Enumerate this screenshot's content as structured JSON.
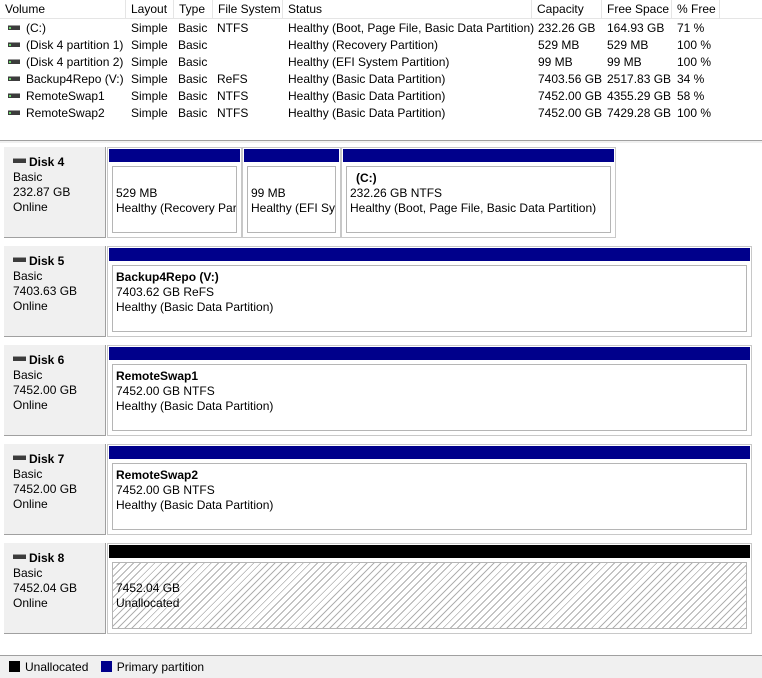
{
  "table": {
    "columns": [
      "Volume",
      "Layout",
      "Type",
      "File System",
      "Status",
      "Capacity",
      "Free Space",
      "% Free"
    ],
    "rows": [
      [
        "(C:)",
        "Simple",
        "Basic",
        "NTFS",
        "Healthy (Boot, Page File, Basic Data Partition)",
        "232.26 GB",
        "164.93 GB",
        "71 %"
      ],
      [
        "(Disk 4 partition 1)",
        "Simple",
        "Basic",
        "",
        "Healthy (Recovery Partition)",
        "529 MB",
        "529 MB",
        "100 %"
      ],
      [
        "(Disk 4 partition 2)",
        "Simple",
        "Basic",
        "",
        "Healthy (EFI System Partition)",
        "99 MB",
        "99 MB",
        "100 %"
      ],
      [
        "Backup4Repo (V:)",
        "Simple",
        "Basic",
        "ReFS",
        "Healthy (Basic Data Partition)",
        "7403.56 GB",
        "2517.83 GB",
        "34 %"
      ],
      [
        "RemoteSwap1",
        "Simple",
        "Basic",
        "NTFS",
        "Healthy (Basic Data Partition)",
        "7452.00 GB",
        "4355.29 GB",
        "58 %"
      ],
      [
        "RemoteSwap2",
        "Simple",
        "Basic",
        "NTFS",
        "Healthy (Basic Data Partition)",
        "7452.00 GB",
        "7429.28 GB",
        "100 %"
      ]
    ]
  },
  "disks": [
    {
      "name": "Disk 4",
      "type": "Basic",
      "size": "232.87 GB",
      "status": "Online",
      "partitions": [
        {
          "title": "",
          "size": "529 MB",
          "status": "Healthy (Recovery Part"
        },
        {
          "title": "",
          "size": "99 MB",
          "status": "Healthy (EFI Sys"
        },
        {
          "title": "(C:)",
          "size": "232.26 GB NTFS",
          "status": "Healthy (Boot, Page File, Basic Data Partition)"
        }
      ]
    },
    {
      "name": "Disk 5",
      "type": "Basic",
      "size": "7403.63 GB",
      "status": "Online",
      "partitions": [
        {
          "title": "Backup4Repo  (V:)",
          "size": "7403.62 GB ReFS",
          "status": "Healthy (Basic Data Partition)"
        }
      ]
    },
    {
      "name": "Disk 6",
      "type": "Basic",
      "size": "7452.00 GB",
      "status": "Online",
      "partitions": [
        {
          "title": "RemoteSwap1",
          "size": "7452.00 GB NTFS",
          "status": "Healthy (Basic Data Partition)"
        }
      ]
    },
    {
      "name": "Disk 7",
      "type": "Basic",
      "size": "7452.00 GB",
      "status": "Online",
      "partitions": [
        {
          "title": "RemoteSwap2",
          "size": "7452.00 GB NTFS",
          "status": "Healthy (Basic Data Partition)"
        }
      ]
    },
    {
      "name": "Disk 8",
      "type": "Basic",
      "size": "7452.04 GB",
      "status": "Online",
      "partitions": [
        {
          "title": "",
          "size": "7452.04 GB",
          "status": "Unallocated"
        }
      ]
    }
  ],
  "legend": {
    "unallocated": "Unallocated",
    "primary": "Primary partition"
  },
  "colors": {
    "primary_partition": "#00008b",
    "unallocated": "#000000"
  },
  "icons": {
    "volume": "drive-icon",
    "disk": "disk-icon"
  }
}
